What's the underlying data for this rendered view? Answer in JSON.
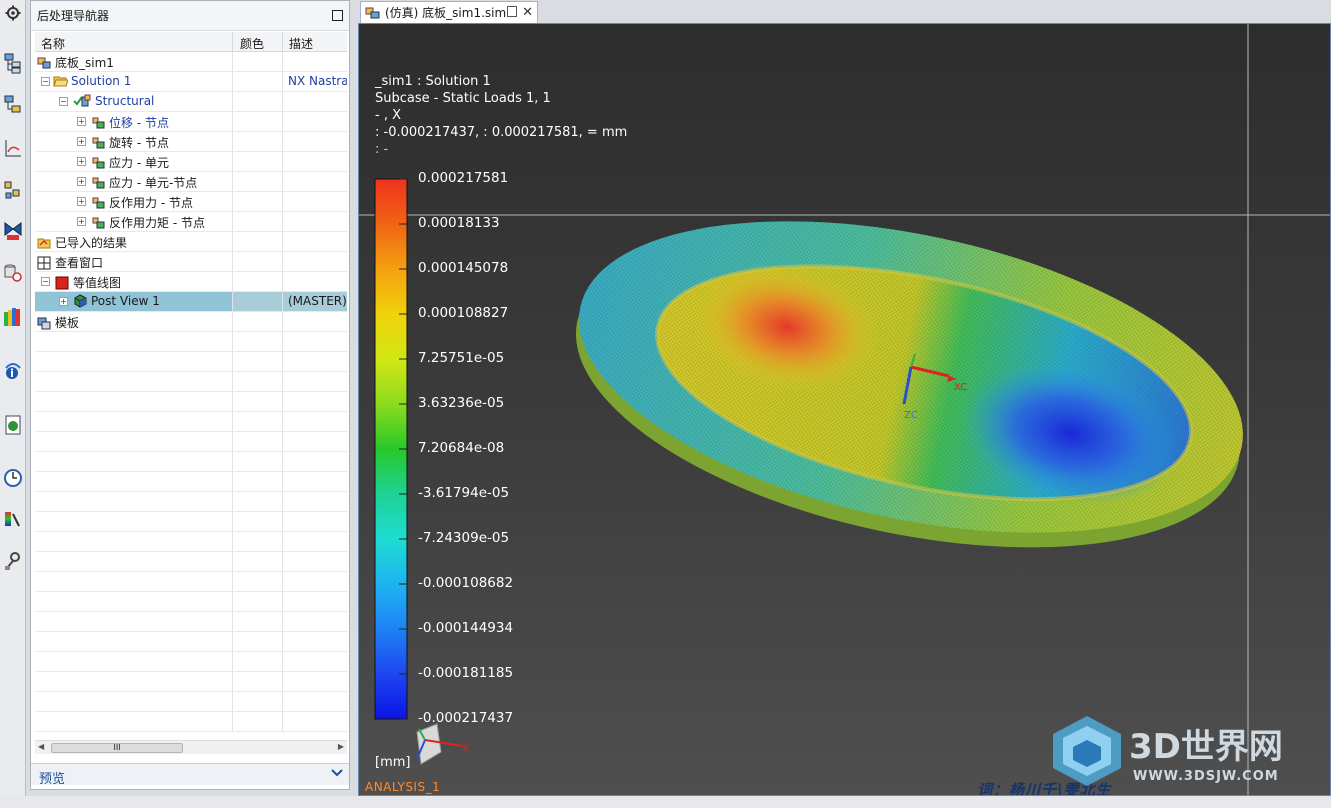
{
  "navigator": {
    "title": "后处理导航器",
    "columns": {
      "name": "名称",
      "color": "颜色",
      "desc": "描述"
    },
    "tree": [
      {
        "label": "底板_sim1",
        "desc": "",
        "blue": false
      },
      {
        "label": "Solution 1",
        "desc": "NX Nastran",
        "blue": true
      },
      {
        "label": "Structural",
        "desc": "",
        "blue": true
      },
      {
        "label": "位移 - 节点",
        "desc": "",
        "blue": true
      },
      {
        "label": "旋转 - 节点",
        "desc": "",
        "blue": false
      },
      {
        "label": "应力 - 单元",
        "desc": "",
        "blue": false
      },
      {
        "label": "应力 - 单元-节点",
        "desc": "",
        "blue": false
      },
      {
        "label": "反作用力 - 节点",
        "desc": "",
        "blue": false
      },
      {
        "label": "反作用力矩 - 节点",
        "desc": "",
        "blue": false
      },
      {
        "label": "已导入的结果",
        "desc": "",
        "blue": false
      },
      {
        "label": "查看窗口",
        "desc": "",
        "blue": false
      },
      {
        "label": "等值线图",
        "desc": "",
        "blue": false
      },
      {
        "label": "Post View 1",
        "desc": "(MASTER)",
        "blue": false
      },
      {
        "label": "模板",
        "desc": "",
        "blue": false
      }
    ],
    "scroll_thumb": "III",
    "preview_label": "预览"
  },
  "graphics": {
    "tab_label": "(仿真) 底板_sim1.sim",
    "header": {
      "line1": "_sim1 : Solution 1",
      "line2": "Subcase - Static Loads 1,  1",
      "line3": " - , X",
      " line4": "",
      "line4": " : -0.000217437,  : 0.000217581,  = mm",
      "line5": " :  -"
    },
    "legend": {
      "values": [
        "0.000217581",
        "0.00018133",
        "0.000145078",
        "0.000108827",
        "7.25751e-05",
        "3.63236e-05",
        "7.20684e-08",
        "-3.61794e-05",
        "-7.24309e-05",
        "-0.000108682",
        "-0.000144934",
        "-0.000181185",
        "-0.000217437"
      ],
      "colors": [
        "#f0321e",
        "#f06414",
        "#f5a010",
        "#f0d20a",
        "#d2e614",
        "#8cdc1e",
        "#28c828",
        "#1ed296",
        "#1edcd2",
        "#1eb4f0",
        "#1e82f5",
        "#1e46f0",
        "#0a14e6"
      ],
      "unit": "[mm]"
    },
    "triad": {
      "xc": "XC",
      "zc": "ZC",
      "x": "X"
    },
    "analysis_label": "ANALYSIS_1",
    "watermark": "词：杨川千|雯北生",
    "logo": {
      "text": "3D世界网",
      "url_text": "WWW.3DSJW.COM"
    }
  },
  "colors": {
    "accent": "#1f3fa5",
    "selected_row": "#90c3d6",
    "analysis": "#ff8c2a"
  }
}
